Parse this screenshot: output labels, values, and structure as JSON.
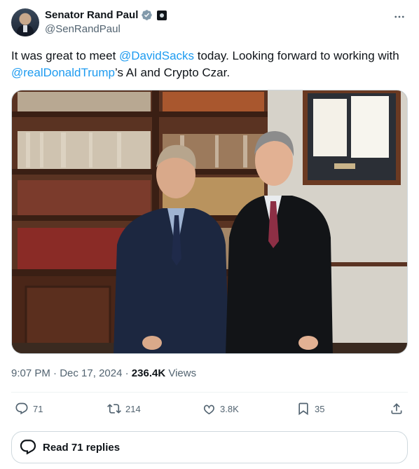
{
  "author": {
    "name": "Senator Rand Paul",
    "handle": "@SenRandPaul"
  },
  "tweet": {
    "part1": "It was great to meet ",
    "mention1": "@DavidSacks",
    "part2": " today. Looking forward to working with ",
    "mention2": "@realDonaldTrump",
    "part3": "’s AI and Crypto Czar."
  },
  "meta": {
    "time": "9:07 PM",
    "sep1": " · ",
    "date": "Dec 17, 2024",
    "sep2": " · ",
    "views_count": "236.4K",
    "views_label": " Views"
  },
  "actions": {
    "replies": "71",
    "reposts": "214",
    "likes": "3.8K",
    "bookmarks": "35"
  },
  "read_replies": "Read 71 replies",
  "colors": {
    "accent": "#1d9bf0",
    "text": "#0f1419",
    "secondary": "#536471"
  }
}
